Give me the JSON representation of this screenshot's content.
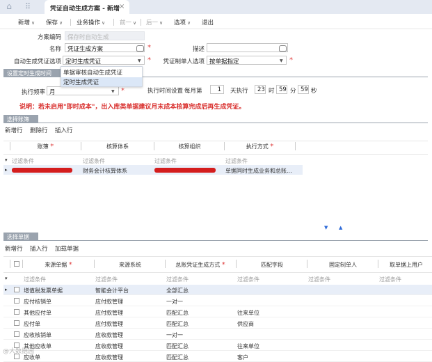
{
  "tabs": {
    "active_title": "凭证自动生成方案 - 新增",
    "close_glyph": "×"
  },
  "toolbar": {
    "new": "新增",
    "save": "保存",
    "biz": "业务操作",
    "prev": "前一",
    "next": "后一",
    "options": "选项",
    "exit": "退出"
  },
  "form": {
    "code_label": "方案编码",
    "code_placeholder": "保存时自动生成",
    "name_label": "名称",
    "name_value": "凭证生成方案",
    "desc_label": "描述",
    "desc_value": "",
    "option_label": "自动生成凭证选项",
    "option_value": "定时生成凭证",
    "maker_label": "凭证制单人选项",
    "maker_value": "按单据指定",
    "option_list": [
      "单据审核自动生成凭证",
      "定时生成凭证"
    ]
  },
  "timer": {
    "section": "设置定时生成时间",
    "freq_label": "执行频率",
    "freq_value": "月",
    "setting_label": "执行时间设置",
    "monthly": "每月第",
    "day": "1",
    "day_suffix": "天执行",
    "hour": "23",
    "hour_unit": "时",
    "minute": "59",
    "minute_unit": "分",
    "second": "59",
    "second_unit": "秒"
  },
  "notice": "说明：若未启用\"即时成本\"，出入库类单据建议月末成本核算完成后再生成凭证。",
  "books": {
    "section": "选择账簿",
    "actions": [
      "新增行",
      "删除行",
      "插入行"
    ],
    "columns": [
      "账簿",
      "核算体系",
      "核算组织",
      "执行方式"
    ],
    "filter": "过滤条件",
    "rows": [
      {
        "system": "财务会计核算体系",
        "mode": "单据同时生成业务和总账..."
      }
    ]
  },
  "docs": {
    "section": "选择单据",
    "actions": [
      "新增行",
      "插入行",
      "加载单据"
    ],
    "columns": [
      "来源单据",
      "来源系统",
      "总账凭证生成方式",
      "匹配字段",
      "固定制单人",
      "取单据上用户"
    ],
    "filter": "过滤条件",
    "rows": [
      {
        "doc": "增值税发票单据",
        "sys": "智能会计平台",
        "mode": "全部汇总",
        "field": ""
      },
      {
        "doc": "应付核销单",
        "sys": "应付款管理",
        "mode": "一对一",
        "field": ""
      },
      {
        "doc": "其他应付单",
        "sys": "应付款管理",
        "mode": "匹配汇总",
        "field": "往来单位"
      },
      {
        "doc": "应付单",
        "sys": "应付款管理",
        "mode": "匹配汇总",
        "field": "供应商"
      },
      {
        "doc": "应收核销单",
        "sys": "应收款管理",
        "mode": "一对一",
        "field": ""
      },
      {
        "doc": "其他应收单",
        "sys": "应收款管理",
        "mode": "匹配汇总",
        "field": "往来单位"
      },
      {
        "doc": "应收单",
        "sys": "应收款管理",
        "mode": "匹配汇总",
        "field": "客户"
      }
    ]
  },
  "watermark": "@大数据园",
  "colors": {
    "section": "#9aa3ae",
    "accent": "#d9302e",
    "selected_row": "#dbe7f7",
    "redaction": "#d41d1d"
  }
}
